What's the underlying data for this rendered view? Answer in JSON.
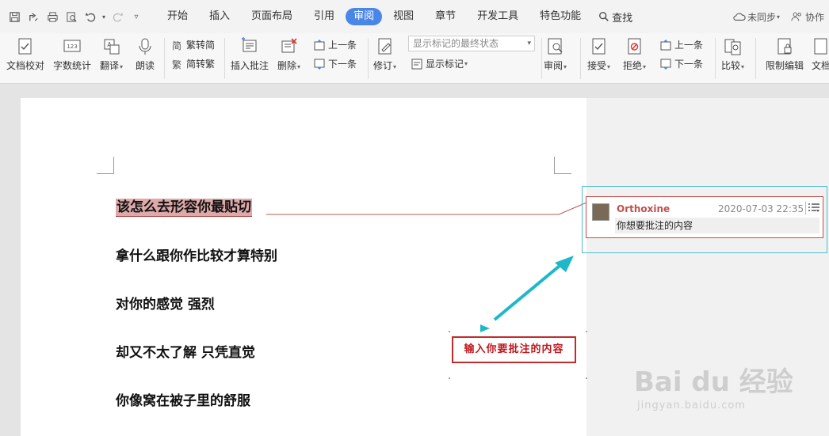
{
  "menubar": {
    "tabs": [
      {
        "label": "开始"
      },
      {
        "label": "插入"
      },
      {
        "label": "页面布局"
      },
      {
        "label": "引用"
      },
      {
        "label": "审阅",
        "active": true
      },
      {
        "label": "视图"
      },
      {
        "label": "章节"
      },
      {
        "label": "开发工具"
      },
      {
        "label": "特色功能"
      }
    ],
    "search": "查找",
    "sync": "未同步",
    "collab": "协作"
  },
  "ribbon": {
    "proof": "文档校对",
    "wordcount": "字数统计",
    "translate": "翻译",
    "read": "朗读",
    "trad": "繁转简",
    "simp": "简转繁",
    "insert_comment": "插入批注",
    "delete": "删除",
    "prev": "上一条",
    "next": "下一条",
    "track": "修订",
    "display_state": "显示标记的最终状态",
    "show_markup": "显示标记",
    "review": "审阅",
    "accept": "接受",
    "reject": "拒绝",
    "prev2": "上一条",
    "next2": "下一条",
    "compare": "比较",
    "restrict": "限制编辑",
    "doc": "文档"
  },
  "document": {
    "lines": [
      "该怎么去形容你最贴切",
      "拿什么跟你作比较才算特别",
      "对你的感觉  强烈",
      "却又不太了解  只凭直觉",
      "你像窝在被子里的舒服"
    ]
  },
  "comment": {
    "author": "Orthoxine",
    "time": "2020-07-03 22:35",
    "text": "你想要批注的内容"
  },
  "callout": {
    "text": "输入你要批注的内容"
  },
  "watermark": {
    "brand": "Bai du 经验",
    "url": "jingyan.baidu.com"
  },
  "colors": {
    "accent": "#4a86e8",
    "comment_border": "#c94a4a",
    "author": "#c0504d",
    "highlight": "#dda9a9",
    "arrow": "#1fb8c8",
    "callout": "#c22b2b"
  }
}
